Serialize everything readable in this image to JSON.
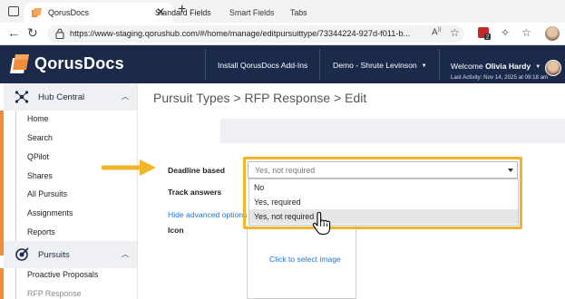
{
  "browser": {
    "tab_title": "QorusDocs",
    "url": "https://www-staging.qorushub.com/#/home/manage/editpursuittype/73344224-927d-f011-b...",
    "extension_badge": "2"
  },
  "header": {
    "brand": "QorusDocs",
    "install_link": "Install QorusDocs Add-Ins",
    "org_selector": "Demo - Shrute Levinson",
    "welcome_prefix": "Welcome",
    "user_name": "Olivia Hardy",
    "last_activity": "Last Activity: Nov 14, 2025 at 09:18 am"
  },
  "sidebar": {
    "hub_central": {
      "label": "Hub Central",
      "items": [
        "Home",
        "Search",
        "QPilot",
        "Shares",
        "All Pursuits",
        "Assignments",
        "Reports"
      ]
    },
    "pursuits": {
      "label": "Pursuits",
      "items": [
        "Proactive Proposals",
        "RFP Response"
      ]
    }
  },
  "main": {
    "breadcrumb": "Pursuit Types > RFP Response > Edit",
    "tabs": [
      "Standard Fields",
      "Smart Fields",
      "Tabs"
    ],
    "active_tab": "Standard Fields",
    "fields": {
      "deadline_label": "Deadline based",
      "deadline_value": "Yes, not required",
      "track_label": "Track answers",
      "advanced_link": "Hide advanced options",
      "icon_label": "Icon",
      "icon_action": "Click to select image"
    },
    "dropdown_options": [
      "No",
      "Yes, required",
      "Yes, not required"
    ],
    "highlighted_option": "Yes, not required"
  },
  "colors": {
    "header_bg": "#1b2a4a",
    "accent_orange": "#f28c38",
    "highlight_yellow": "#f1b52b",
    "link_blue": "#1f77c9"
  }
}
